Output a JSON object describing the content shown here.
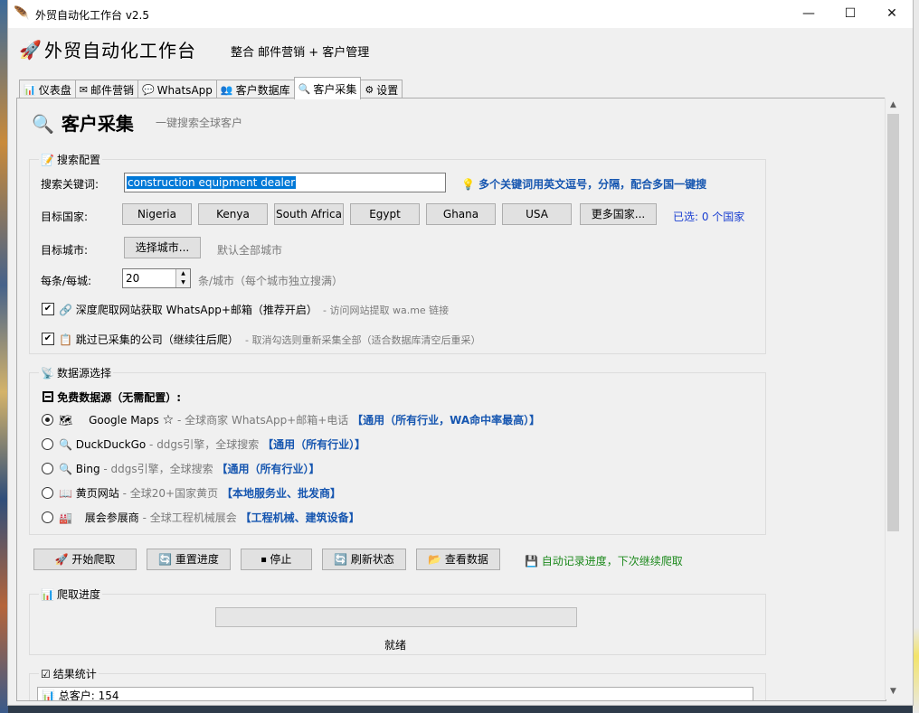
{
  "window": {
    "title": "外贸自动化工作台 v2.5"
  },
  "header": {
    "app_name": "外贸自动化工作台",
    "subtitle": "整合 邮件营销 + 客户管理"
  },
  "tabs": [
    {
      "label": "仪表盘"
    },
    {
      "label": "邮件营销"
    },
    {
      "label": "WhatsApp"
    },
    {
      "label": "客户数据库"
    },
    {
      "label": "客户采集",
      "active": true
    },
    {
      "label": "设置"
    }
  ],
  "page": {
    "title": "客户采集",
    "subtitle": "一键搜索全球客户"
  },
  "search_config": {
    "group_label": "搜索配置",
    "keyword_label": "搜索关键词:",
    "keyword_value": "construction equipment dealer",
    "keyword_hint": "多个关键词用英文逗号，分隔，配合多国一键搜",
    "country_label": "目标国家:",
    "countries": [
      "Nigeria",
      "Kenya",
      "South Africa",
      "Egypt",
      "Ghana",
      "USA"
    ],
    "more_countries": "更多国家...",
    "selected_count": "已选: 0 个国家",
    "city_label": "目标城市:",
    "city_button": "选择城市...",
    "city_hint": "默认全部城市",
    "per_label": "每条/每城:",
    "per_value": "20",
    "per_unit": "条/城市（每个城市独立搜满）",
    "deep_crawl_label": "深度爬取网站获取 WhatsApp+邮箱（推荐开启）",
    "deep_crawl_hint": "- 访问网站提取 wa.me 链接",
    "deep_crawl_checked": true,
    "skip_label": "跳过已采集的公司（继续往后爬）",
    "skip_hint": "- 取消勾选则重新采集全部（适合数据库清空后重采）",
    "skip_checked": true
  },
  "sources": {
    "group_label": "数据源选择",
    "free_header": "免费数据源（无需配置）:",
    "items": [
      {
        "name": "Google Maps",
        "star": "☆",
        "desc": "- 全球商家 WhatsApp+邮箱+电话",
        "tag": "【通用（所有行业，WA命中率最高）】",
        "selected": true
      },
      {
        "name": "DuckDuckGo",
        "desc": "- ddgs引擎，全球搜索",
        "tag": "【通用（所有行业）】",
        "selected": false
      },
      {
        "name": "Bing",
        "desc": "- ddgs引擎，全球搜索",
        "tag": "【通用（所有行业）】",
        "selected": false
      },
      {
        "name": "黄页网站",
        "desc": "- 全球20+国家黄页",
        "tag": "【本地服务业、批发商】",
        "selected": false
      },
      {
        "name": "展会参展商",
        "desc": "- 全球工程机械展会",
        "tag": "【工程机械、建筑设备】",
        "selected": false
      }
    ]
  },
  "actions": {
    "start": "开始爬取",
    "reset": "重置进度",
    "stop": "停止",
    "refresh": "刷新状态",
    "view": "查看数据",
    "autosave_note": "自动记录进度，下次继续爬取"
  },
  "progress": {
    "group_label": "爬取进度",
    "status": "就绪",
    "value": 0
  },
  "stats": {
    "group_label": "结果统计",
    "total_label": "总客户: 154"
  },
  "colors": {
    "accent": "#1656b0",
    "selection": "#0078d7",
    "success": "#1e8a1e"
  }
}
